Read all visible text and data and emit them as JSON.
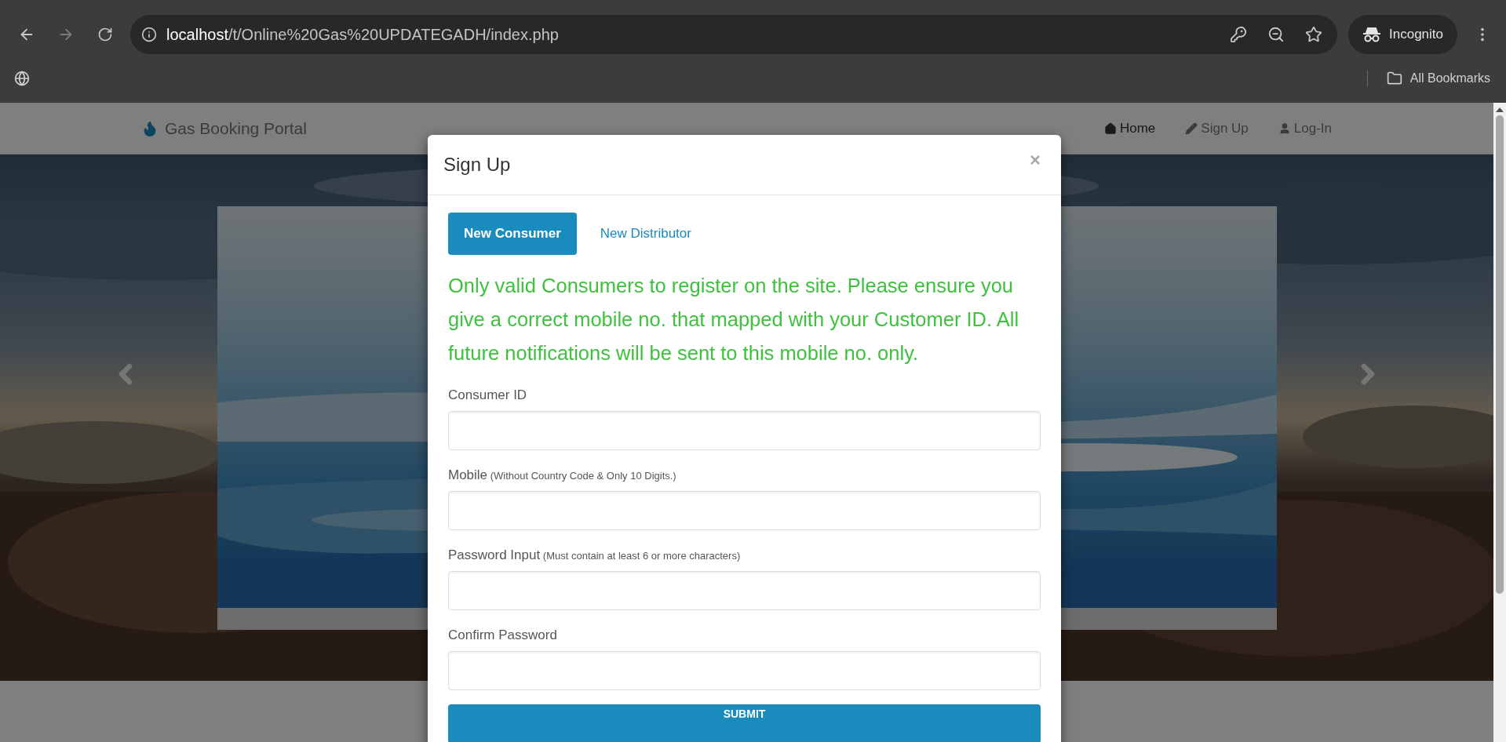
{
  "browser": {
    "url_host": "localhost",
    "url_path": "/t/Online%20Gas%20UPDATEGADH/index.php",
    "profile": "Incognito",
    "bookmarks": "All Bookmarks"
  },
  "navbar": {
    "brand": "Gas Booking Portal",
    "links": [
      {
        "label": "Home",
        "kind": "home",
        "selected": true
      },
      {
        "label": "Sign Up",
        "kind": "signup",
        "selected": false
      },
      {
        "label": "Log-In",
        "kind": "login",
        "selected": false
      }
    ]
  },
  "modal": {
    "title": "Sign Up",
    "close": "×",
    "tabs": [
      {
        "label": "New Consumer",
        "selected": true
      },
      {
        "label": "New Distributor",
        "selected": false
      }
    ],
    "notice": "Only valid Consumers to register on the site. Please ensure you give a correct mobile no. that mapped with your Customer ID. All future notifications will be sent to this mobile no. only.",
    "fields": [
      {
        "label": "Consumer ID"
      },
      {
        "label": "Mobile",
        "note": "(Without Country Code & Only 10 Digits.)"
      },
      {
        "label": "Password Input",
        "note": "(Must contain at least 6 or more characters)"
      },
      {
        "label": "Confirm Password"
      }
    ],
    "submit": "SUBMIT"
  }
}
